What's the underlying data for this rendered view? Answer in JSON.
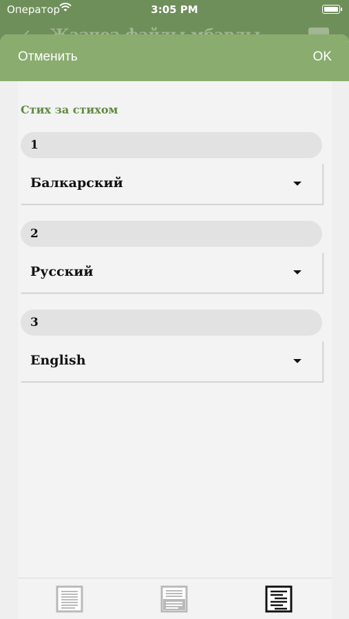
{
  "status_bar": {
    "carrier": "Оператор",
    "time": "3:05 PM"
  },
  "background_nav": {
    "title": "Жазноз файлы мбарлы"
  },
  "sheet": {
    "cancel_label": "Отменить",
    "ok_label": "OK",
    "section_title": "Стих за стихом",
    "rows": [
      {
        "number": "1",
        "language": "Балкарский"
      },
      {
        "number": "2",
        "language": "Русский"
      },
      {
        "number": "3",
        "language": "English"
      }
    ]
  },
  "toolbar": {
    "icons": [
      "single-column-layout-icon",
      "two-pane-layout-icon",
      "verse-by-verse-layout-icon"
    ],
    "selected": "verse-by-verse-layout-icon"
  },
  "colors": {
    "header_green": "#8aac6f",
    "accent_green": "#5f8a3e"
  }
}
